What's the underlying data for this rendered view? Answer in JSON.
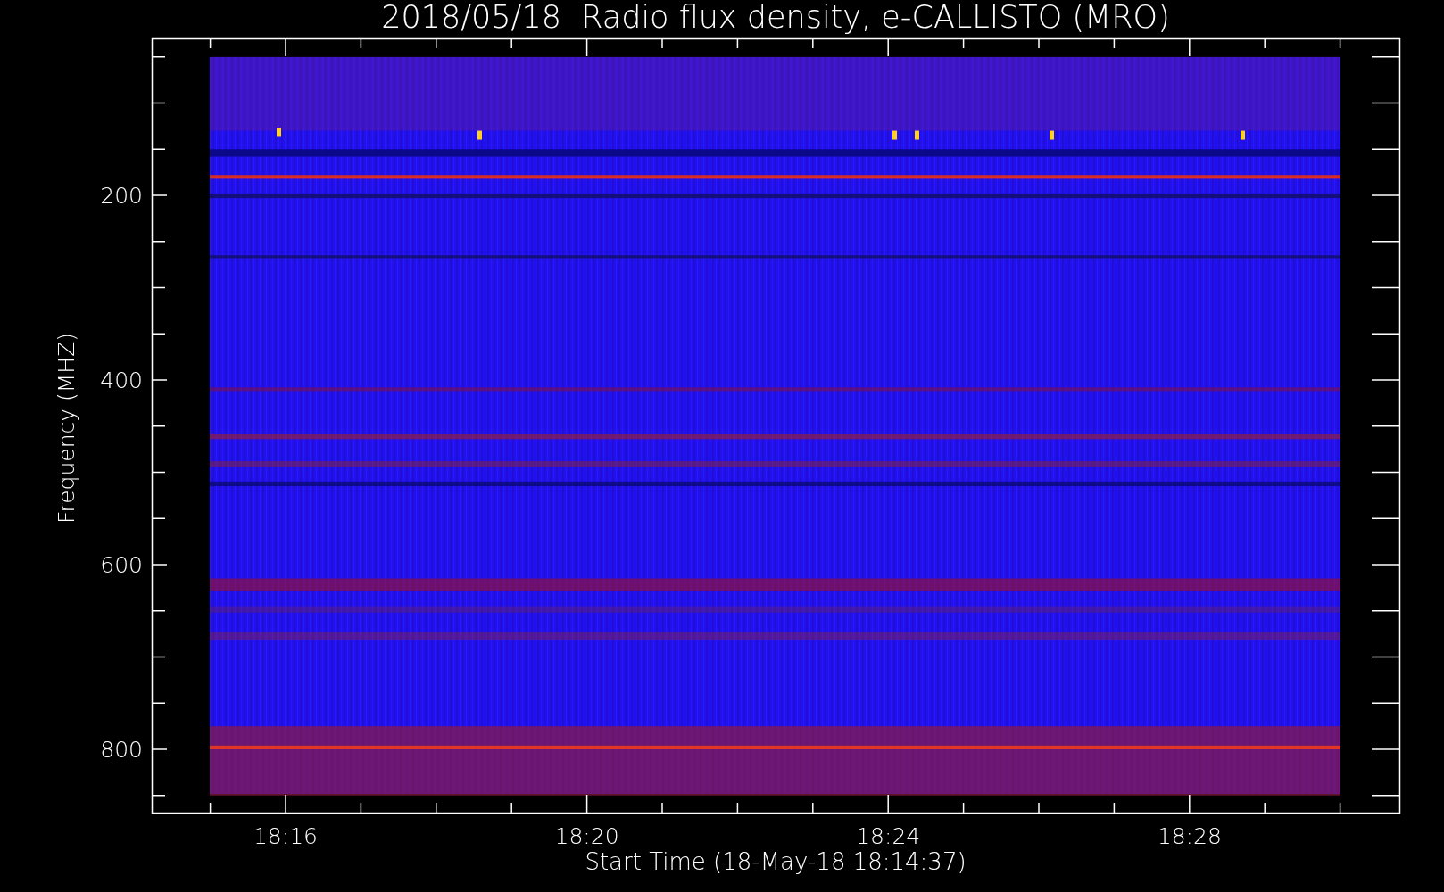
{
  "title": "2018/05/18  Radio flux density, e-CALLISTO (MRO)",
  "plot": {
    "ylabel": "Frequency (MHZ)",
    "xlabel": "Start Time (18-May-18 18:14:37)",
    "yticks": [
      "200",
      "400",
      "600",
      "800"
    ],
    "xticks": [
      "18:16",
      "18:20",
      "18:24",
      "18:28"
    ]
  }
}
